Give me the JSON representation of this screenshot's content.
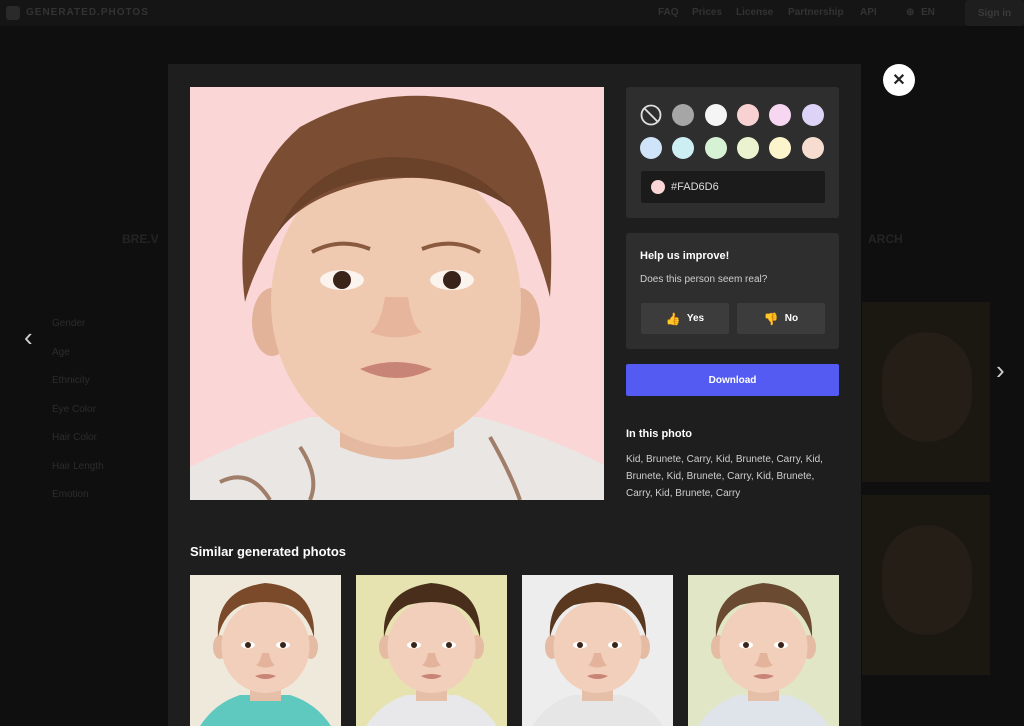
{
  "nav": {
    "logo": "GENERATED.PHOTOS",
    "links": [
      "FAQ",
      "Prices",
      "License",
      "Partnership",
      "API"
    ],
    "language": "EN",
    "signin": "Sign in"
  },
  "background": {
    "heading_left": "BRE.V",
    "heading_right": "ARCH",
    "filters": [
      "Gender",
      "Age",
      "Ethnicity",
      "Eye Color",
      "Hair Color",
      "Hair Length",
      "Emotion"
    ]
  },
  "modal": {
    "close_icon": "close-icon",
    "photo": {
      "background_color": "#fad6d6",
      "subject": "toddler with brown hair"
    },
    "color_picker": {
      "swatches": [
        {
          "name": "none",
          "color": "none"
        },
        {
          "name": "gray",
          "color": "#a6a6a6"
        },
        {
          "name": "white",
          "color": "#f5f5f5"
        },
        {
          "name": "pink",
          "color": "#f8d2d2"
        },
        {
          "name": "light-pink",
          "color": "#f6d6f0"
        },
        {
          "name": "lavender",
          "color": "#dcd3f7"
        },
        {
          "name": "light-blue",
          "color": "#cfe4f8"
        },
        {
          "name": "cyan",
          "color": "#cdeff4"
        },
        {
          "name": "mint",
          "color": "#d6f2d4"
        },
        {
          "name": "light-lime",
          "color": "#eaf2cf"
        },
        {
          "name": "cream",
          "color": "#fbf4cc"
        },
        {
          "name": "peach",
          "color": "#f7ddd0"
        }
      ],
      "selected_color": "#FAD6D6",
      "hex_value": "#FAD6D6"
    },
    "feedback": {
      "title": "Help us improve!",
      "question": "Does this person seem real?",
      "yes_label": "Yes",
      "no_label": "No"
    },
    "download_label": "Download",
    "in_this_photo_title": "In this photo",
    "tags": "Kid, Brunete, Carry, Kid, Brunete, Carry, Kid, Brunete, Kid, Brunete, Carry, Kid, Brunete, Carry, Kid, Brunete, Carry",
    "similar_title": "Similar generated photos",
    "similar": [
      {
        "bg": "#efe9dc",
        "hair": "#7a4a2a",
        "shirt": "#5fc9c0"
      },
      {
        "bg": "#e7e3b0",
        "hair": "#4a2e1c",
        "shirt": "#e8e8ea"
      },
      {
        "bg": "#ededed",
        "hair": "#5a3820",
        "shirt": "#e6e6e6"
      },
      {
        "bg": "#e1e7c6",
        "hair": "#6a4a30",
        "shirt": "#dfe4ea"
      }
    ]
  }
}
